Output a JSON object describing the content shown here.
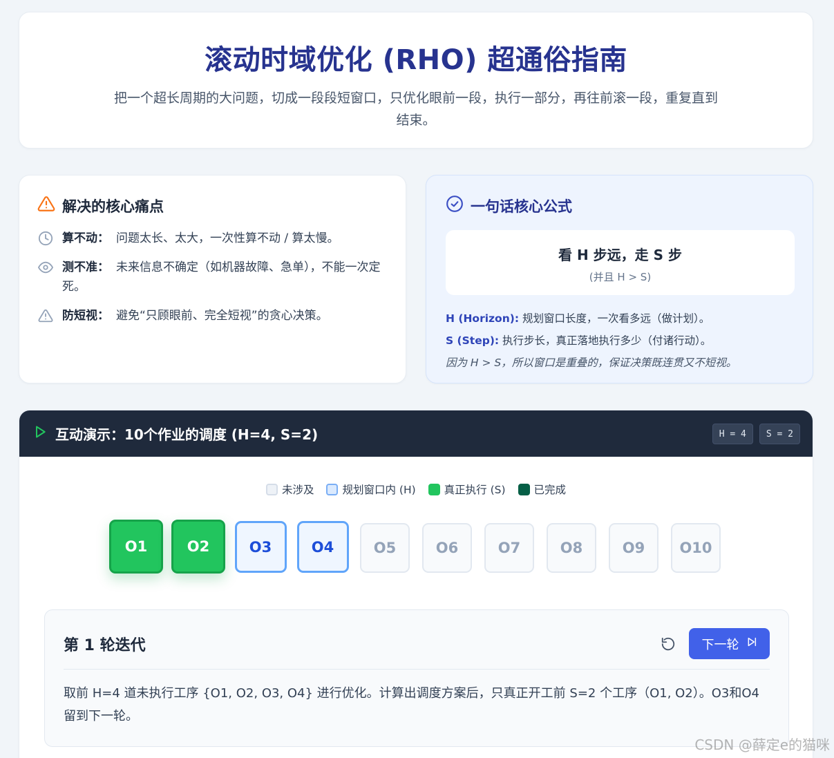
{
  "hero": {
    "title": "滚动时域优化 (RHO) 超通俗指南",
    "subtitle": "把一个超长周期的大问题，切成一段段短窗口，只优化眼前一段，执行一部分，再往前滚一段，重复直到结束。"
  },
  "pain": {
    "title": "解决的核心痛点",
    "title_icon": "warning-triangle-icon",
    "items": [
      {
        "icon": "clock-icon",
        "label": "算不动：",
        "text": "问题太长、太大，一次性算不动 / 算太慢。"
      },
      {
        "icon": "eye-icon",
        "label": "测不准：",
        "text": "未来信息不确定（如机器故障、急单），不能一次定死。"
      },
      {
        "icon": "alert-triangle-icon",
        "label": "防短视：",
        "text": "避免“只顾眼前、完全短视”的贪心决策。"
      }
    ]
  },
  "formula": {
    "title": "一句话核心公式",
    "title_icon": "check-circle-icon",
    "main": "看 H 步远，走 S 步",
    "condition": "(并且 H > S)",
    "h_label": "H (Horizon):",
    "h_text": "规划窗口长度，一次看多远（做计划）。",
    "s_label": "S (Step):",
    "s_text": "执行步长，真正落地执行多少（付诸行动）。",
    "note": "因为 H > S，所以窗口是重叠的，保证决策既连贯又不短视。"
  },
  "demo": {
    "title": "互动演示：10个作业的调度 (H=4, S=2)",
    "h_chip": "H = 4",
    "s_chip": "S = 2",
    "legend": [
      {
        "label": "未涉及",
        "color": "#eef2f7",
        "border": "#d5dde8"
      },
      {
        "label": "规划窗口内 (H)",
        "color": "#dbeafe",
        "border": "#7aaef5"
      },
      {
        "label": "真正执行 (S)",
        "color": "#22c55e",
        "border": "#22c55e"
      },
      {
        "label": "已完成",
        "color": "#065f46",
        "border": "#065f46"
      }
    ],
    "jobs": [
      {
        "label": "O1",
        "state": "exec"
      },
      {
        "label": "O2",
        "state": "exec"
      },
      {
        "label": "O3",
        "state": "plan"
      },
      {
        "label": "O4",
        "state": "plan"
      },
      {
        "label": "O5",
        "state": "idle"
      },
      {
        "label": "O6",
        "state": "idle"
      },
      {
        "label": "O7",
        "state": "idle"
      },
      {
        "label": "O8",
        "state": "idle"
      },
      {
        "label": "O9",
        "state": "idle"
      },
      {
        "label": "O10",
        "state": "idle"
      }
    ],
    "iteration": {
      "round": "第 1 轮迭代",
      "next_label": "下一轮",
      "text": "取前 H=4 道未执行工序 {O1, O2, O3, O4} 进行优化。计算出调度方案后，只真正开工前 S=2 个工序（O1, O2）。O3和O4留到下一轮。"
    }
  },
  "watermark": "CSDN @薛定e的猫咪"
}
